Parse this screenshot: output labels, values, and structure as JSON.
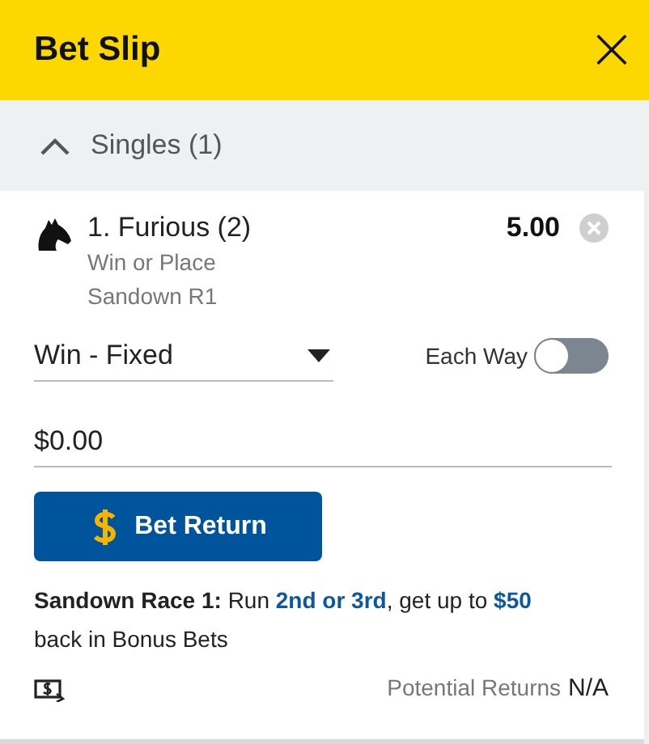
{
  "header": {
    "title": "Bet Slip",
    "close": "×"
  },
  "section": {
    "label": "Singles (1)",
    "expanded": true
  },
  "bet": {
    "runner": "1. Furious (2)",
    "market": "Win or Place",
    "race": "Sandown R1",
    "odds": "5.00",
    "bet_type": "Win - Fixed",
    "each_way": {
      "label": "Each Way",
      "on": false
    },
    "stake": {
      "value": "$0.00"
    },
    "button": "Bet Return",
    "promo": {
      "lead": "Sandown Race 1:",
      "text": "Run **2nd or 3rd**, get up to **$50** back in Bonus Bets"
    },
    "returns": {
      "label": "Potential Returns",
      "value": "N/A"
    }
  }
}
